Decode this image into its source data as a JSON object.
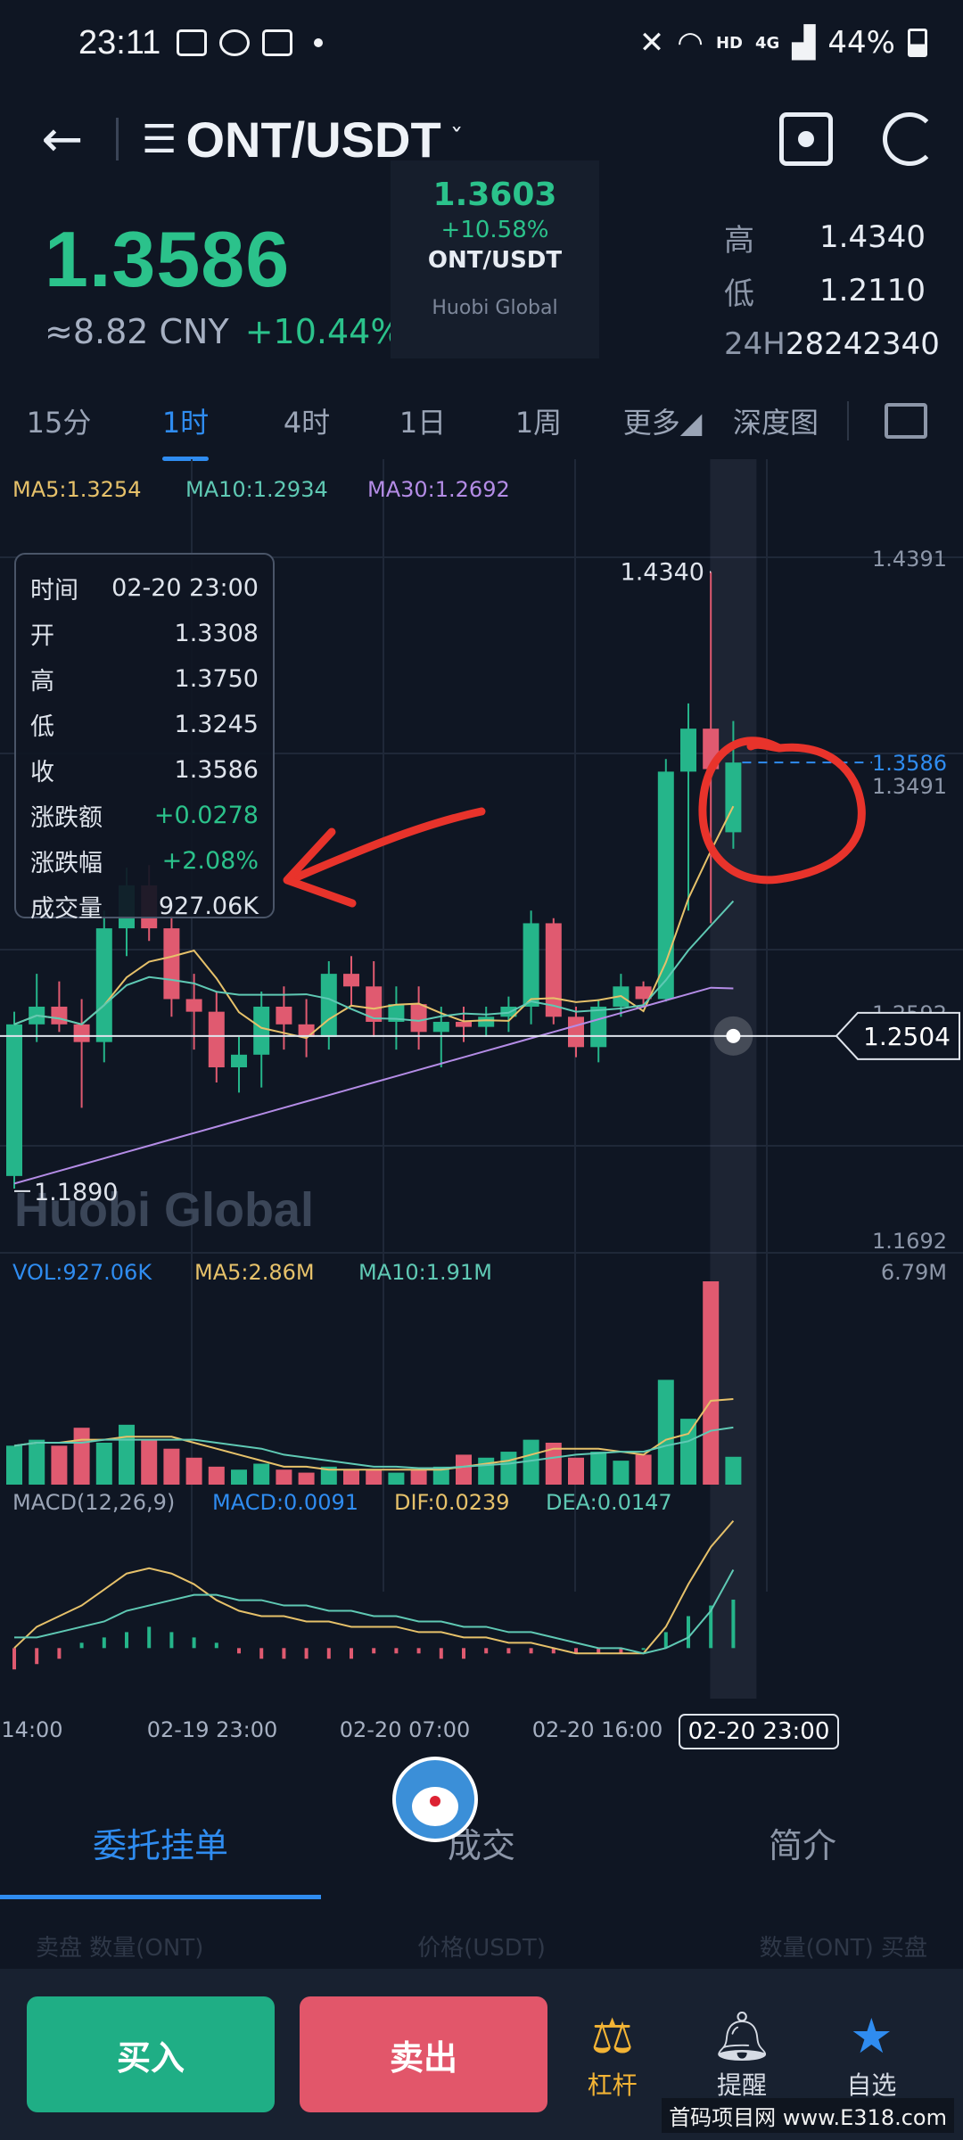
{
  "status_bar": {
    "time": "23:11",
    "network": "HD",
    "signal_label": "4G",
    "battery": "44%"
  },
  "header": {
    "pair": "ONT/USDT",
    "caret": "ˇ"
  },
  "ticker": {
    "last_price": "1.3586",
    "cny": "≈8.82 CNY",
    "change_pct": "+10.44%",
    "stats": [
      {
        "label": "高",
        "value": "1.4340"
      },
      {
        "label": "低",
        "value": "1.2110"
      },
      {
        "label": "24H",
        "value": "28242340"
      }
    ]
  },
  "floating_card": {
    "price": "1.3603",
    "change": "+10.58%",
    "pair": "ONT/USDT",
    "brand": "Huobi Global"
  },
  "interval_tabs": [
    {
      "label": "15分",
      "active": false
    },
    {
      "label": "1时",
      "active": true
    },
    {
      "label": "4时",
      "active": false
    },
    {
      "label": "1日",
      "active": false
    },
    {
      "label": "1周",
      "active": false
    },
    {
      "label": "更多◢",
      "active": false
    },
    {
      "label": "深度图",
      "active": false
    }
  ],
  "chart_data": {
    "type": "candlestick",
    "ma_legend": [
      {
        "label": "MA5:1.3254",
        "color": "#e6c16a"
      },
      {
        "label": "MA10:1.2934",
        "color": "#5fc9b4"
      },
      {
        "label": "MA30:1.2692",
        "color": "#b48ce6"
      }
    ],
    "y_ticks": [
      "1.4391",
      "1.3491",
      "1.2592",
      "1.1692"
    ],
    "y_range": [
      1.1692,
      1.4391
    ],
    "watermark": "Huobi Global",
    "high_label": "1.4340",
    "low_label": "1.1890",
    "last_price_label": "1.3586",
    "crosshair_label": "1.2504",
    "crosshair_price": 1.2504,
    "colors": {
      "up": "#25b58a",
      "down": "#e05a70",
      "ma5": "#e6c16a",
      "ma10": "#5fc9b4",
      "ma30": "#b48ce6",
      "annotation": "#e8332b"
    },
    "candles": [
      {
        "o": 1.195,
        "h": 1.26,
        "l": 1.19,
        "c": 1.255
      },
      {
        "o": 1.255,
        "h": 1.275,
        "l": 1.248,
        "c": 1.262
      },
      {
        "o": 1.262,
        "h": 1.272,
        "l": 1.252,
        "c": 1.255
      },
      {
        "o": 1.255,
        "h": 1.265,
        "l": 1.222,
        "c": 1.248
      },
      {
        "o": 1.248,
        "h": 1.3,
        "l": 1.24,
        "c": 1.293
      },
      {
        "o": 1.293,
        "h": 1.317,
        "l": 1.282,
        "c": 1.31
      },
      {
        "o": 1.31,
        "h": 1.318,
        "l": 1.288,
        "c": 1.293
      },
      {
        "o": 1.293,
        "h": 1.298,
        "l": 1.258,
        "c": 1.265
      },
      {
        "o": 1.265,
        "h": 1.275,
        "l": 1.245,
        "c": 1.26
      },
      {
        "o": 1.26,
        "h": 1.268,
        "l": 1.232,
        "c": 1.238
      },
      {
        "o": 1.238,
        "h": 1.25,
        "l": 1.228,
        "c": 1.243
      },
      {
        "o": 1.243,
        "h": 1.268,
        "l": 1.23,
        "c": 1.262
      },
      {
        "o": 1.262,
        "h": 1.27,
        "l": 1.245,
        "c": 1.255
      },
      {
        "o": 1.255,
        "h": 1.265,
        "l": 1.242,
        "c": 1.25
      },
      {
        "o": 1.25,
        "h": 1.28,
        "l": 1.245,
        "c": 1.275
      },
      {
        "o": 1.275,
        "h": 1.282,
        "l": 1.262,
        "c": 1.27
      },
      {
        "o": 1.27,
        "h": 1.28,
        "l": 1.25,
        "c": 1.256
      },
      {
        "o": 1.256,
        "h": 1.27,
        "l": 1.245,
        "c": 1.263
      },
      {
        "o": 1.263,
        "h": 1.27,
        "l": 1.245,
        "c": 1.252
      },
      {
        "o": 1.252,
        "h": 1.262,
        "l": 1.238,
        "c": 1.256
      },
      {
        "o": 1.256,
        "h": 1.262,
        "l": 1.248,
        "c": 1.254
      },
      {
        "o": 1.254,
        "h": 1.262,
        "l": 1.25,
        "c": 1.258
      },
      {
        "o": 1.258,
        "h": 1.266,
        "l": 1.252,
        "c": 1.262
      },
      {
        "o": 1.262,
        "h": 1.3,
        "l": 1.255,
        "c": 1.295
      },
      {
        "o": 1.295,
        "h": 1.297,
        "l": 1.255,
        "c": 1.258
      },
      {
        "o": 1.258,
        "h": 1.262,
        "l": 1.242,
        "c": 1.246
      },
      {
        "o": 1.246,
        "h": 1.265,
        "l": 1.24,
        "c": 1.262
      },
      {
        "o": 1.262,
        "h": 1.275,
        "l": 1.258,
        "c": 1.27
      },
      {
        "o": 1.27,
        "h": 1.272,
        "l": 1.262,
        "c": 1.265
      },
      {
        "o": 1.265,
        "h": 1.36,
        "l": 1.264,
        "c": 1.355
      },
      {
        "o": 1.355,
        "h": 1.382,
        "l": 1.3,
        "c": 1.372
      },
      {
        "o": 1.372,
        "h": 1.434,
        "l": 1.295,
        "c": 1.356
      },
      {
        "o": 1.331,
        "h": 1.375,
        "l": 1.3245,
        "c": 1.3586
      }
    ],
    "volume": {
      "legend": [
        {
          "label": "VOL:927.06K",
          "color": "#2f8cf0"
        },
        {
          "label": "MA5:2.86M",
          "color": "#e6c16a"
        },
        {
          "label": "MA10:1.91M",
          "color": "#5fc9b4"
        }
      ],
      "max_label": "6.79M",
      "max": 6.79,
      "values": [
        1.3,
        1.5,
        1.3,
        1.9,
        1.4,
        2.0,
        1.5,
        1.2,
        0.9,
        0.6,
        0.5,
        0.7,
        0.5,
        0.4,
        0.6,
        0.5,
        0.5,
        0.4,
        0.5,
        0.6,
        1.0,
        0.9,
        1.1,
        1.5,
        1.4,
        0.9,
        1.1,
        0.8,
        1.0,
        3.5,
        2.2,
        6.79,
        0.93
      ],
      "ma5": [
        1.3,
        1.4,
        1.4,
        1.5,
        1.5,
        1.6,
        1.6,
        1.6,
        1.4,
        1.2,
        1.0,
        0.8,
        0.6,
        0.6,
        0.5,
        0.5,
        0.5,
        0.5,
        0.5,
        0.5,
        0.6,
        0.7,
        0.8,
        1.0,
        1.2,
        1.2,
        1.2,
        1.1,
        1.0,
        1.5,
        1.7,
        2.8,
        2.86
      ],
      "ma10": [
        1.3,
        1.4,
        1.4,
        1.4,
        1.5,
        1.5,
        1.5,
        1.5,
        1.5,
        1.4,
        1.3,
        1.2,
        1.0,
        0.9,
        0.8,
        0.7,
        0.6,
        0.6,
        0.55,
        0.55,
        0.6,
        0.65,
        0.7,
        0.8,
        0.9,
        1.0,
        1.05,
        1.1,
        1.1,
        1.3,
        1.45,
        1.8,
        1.91
      ]
    },
    "macd": {
      "legend": [
        {
          "label": "MACD(12,26,9)",
          "color": "#9aa4b6"
        },
        {
          "label": "MACD:0.0091",
          "color": "#2f8cf0"
        },
        {
          "label": "DIF:0.0239",
          "color": "#e6c16a"
        },
        {
          "label": "DEA:0.0147",
          "color": "#5fc9b4"
        }
      ],
      "range": [
        -0.012,
        0.024
      ],
      "dif": [
        0.0,
        0.004,
        0.006,
        0.008,
        0.011,
        0.014,
        0.015,
        0.014,
        0.012,
        0.009,
        0.007,
        0.006,
        0.006,
        0.005,
        0.005,
        0.004,
        0.004,
        0.004,
        0.003,
        0.003,
        0.002,
        0.002,
        0.001,
        0.001,
        0.0,
        -0.001,
        -0.001,
        -0.001,
        -0.001,
        0.004,
        0.012,
        0.019,
        0.0239
      ],
      "dea": [
        0.002,
        0.002,
        0.003,
        0.004,
        0.005,
        0.007,
        0.008,
        0.009,
        0.01,
        0.01,
        0.009,
        0.009,
        0.008,
        0.008,
        0.007,
        0.007,
        0.006,
        0.006,
        0.005,
        0.005,
        0.004,
        0.004,
        0.003,
        0.003,
        0.002,
        0.001,
        0.0,
        0.0,
        -0.001,
        0.0,
        0.002,
        0.007,
        0.0147
      ],
      "hist": [
        -0.004,
        -0.003,
        -0.002,
        0.001,
        0.002,
        0.003,
        0.004,
        0.003,
        0.002,
        0.001,
        -0.001,
        -0.002,
        -0.002,
        -0.002,
        -0.002,
        -0.002,
        -0.001,
        -0.001,
        -0.001,
        -0.002,
        -0.002,
        -0.001,
        -0.001,
        -0.001,
        -0.001,
        -0.001,
        -0.001,
        -0.001,
        0.0,
        0.003,
        0.006,
        0.008,
        0.0091
      ]
    },
    "x_ticks": [
      "14:00",
      "02-19 23:00",
      "02-20 07:00",
      "02-20 16:00"
    ],
    "x_selected": "02-20 23:00"
  },
  "info_panel": {
    "rows": [
      {
        "label": "时间",
        "value": "02-20 23:00",
        "up": false
      },
      {
        "label": "开",
        "value": "1.3308",
        "up": false
      },
      {
        "label": "高",
        "value": "1.3750",
        "up": false
      },
      {
        "label": "低",
        "value": "1.3245",
        "up": false
      },
      {
        "label": "收",
        "value": "1.3586",
        "up": false
      },
      {
        "label": "涨跌额",
        "value": "+0.0278",
        "up": true
      },
      {
        "label": "涨跌幅",
        "value": "+2.08%",
        "up": true
      },
      {
        "label": "成交量",
        "value": "927.06K",
        "up": false
      }
    ]
  },
  "bottom_tabs": [
    {
      "label": "委托挂单",
      "active": true
    },
    {
      "label": "成交",
      "active": false
    },
    {
      "label": "简介",
      "active": false
    }
  ],
  "faded_header": [
    "卖盘 数量(ONT)",
    "价格(USDT)",
    "数量(ONT) 买盘"
  ],
  "actions": {
    "buy": "买入",
    "sell": "卖出",
    "lever": "杠杆",
    "alert": "提醒",
    "watchlist": "自选"
  },
  "site_watermark": "首码项目网 www.E318.com"
}
